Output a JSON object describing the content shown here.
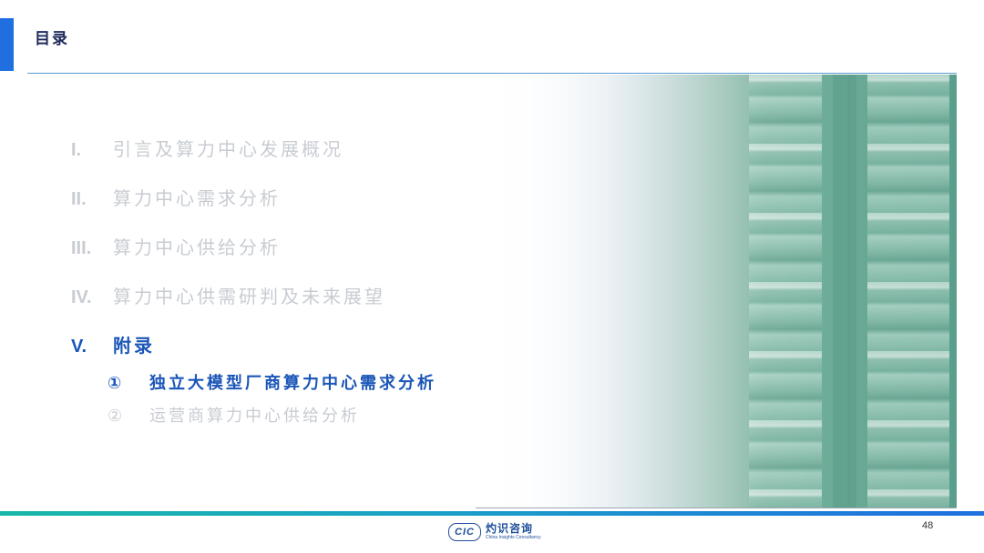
{
  "header": {
    "title": "目录"
  },
  "toc": {
    "items": [
      {
        "num": "I.",
        "label": "引言及算力中心发展概况",
        "active": false
      },
      {
        "num": "II.",
        "label": "算力中心需求分析",
        "active": false
      },
      {
        "num": "III.",
        "label": "算力中心供给分析",
        "active": false
      },
      {
        "num": "IV.",
        "label": "算力中心供需研判及未来展望",
        "active": false
      },
      {
        "num": "V.",
        "label": "附录",
        "active": true
      }
    ],
    "sub_items": [
      {
        "num": "①",
        "label": "独立大模型厂商算力中心需求分析",
        "active": true
      },
      {
        "num": "②",
        "label": "运营商算力中心供给分析",
        "active": false
      }
    ]
  },
  "footer": {
    "logo_mark": "CIC",
    "logo_cn": "灼识咨询",
    "logo_en": "China Insights Consultancy",
    "page_number": "48"
  },
  "colors": {
    "accent": "#1f6fe0",
    "active_text": "#1a55b8",
    "inactive_text": "#c8ccd2"
  }
}
